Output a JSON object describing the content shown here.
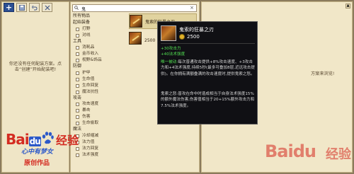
{
  "left_panel": {
    "toolbar": [
      {
        "icon": "plus-icon"
      },
      {
        "icon": "save-icon"
      },
      {
        "icon": "undo-icon"
      },
      {
        "icon": "close-icon"
      }
    ],
    "empty_message": "你还没有任何配装方案。点击“创建”开始配装吧!"
  },
  "search": {
    "value": "鬼",
    "placeholder": ""
  },
  "categories": [
    {
      "label": "所有物品",
      "type": "head"
    },
    {
      "label": "起始装备",
      "type": "head"
    },
    {
      "label": "打野",
      "type": "item"
    },
    {
      "label": "对线",
      "type": "item"
    },
    {
      "label": "工具",
      "type": "head"
    },
    {
      "label": "消耗品",
      "type": "item"
    },
    {
      "label": "金币收入",
      "type": "item"
    },
    {
      "label": "视野&饰品",
      "type": "item"
    },
    {
      "label": "防御",
      "type": "head"
    },
    {
      "label": "护甲",
      "type": "item"
    },
    {
      "label": "生命值",
      "type": "item"
    },
    {
      "label": "生命回复",
      "type": "item"
    },
    {
      "label": "魔法抗性",
      "type": "item"
    },
    {
      "label": "攻击",
      "type": "head"
    },
    {
      "label": "攻击速度",
      "type": "item"
    },
    {
      "label": "暴击",
      "type": "item"
    },
    {
      "label": "伤害",
      "type": "item"
    },
    {
      "label": "生命偷取",
      "type": "item"
    },
    {
      "label": "魔法",
      "type": "head"
    },
    {
      "label": "冷却缩减",
      "type": "item"
    },
    {
      "label": "法力值",
      "type": "item"
    },
    {
      "label": "法力回复",
      "type": "item"
    },
    {
      "label": "法术强度",
      "type": "item"
    }
  ],
  "results": [
    {
      "name": "鬼索的狂暴之刃",
      "price": ""
    },
    {
      "name": "",
      "price": "2500"
    }
  ],
  "right_panel": {
    "message": "方案来浏览!"
  },
  "tooltip": {
    "title": "鬼索的狂暴之刃",
    "price": "2500",
    "stat1": "+30攻击力",
    "stat2": "+40法术强度",
    "passive_label": "唯一被动:",
    "passive_text": "每次普通攻击提供+8%攻击速度、+3攻击力和+4法术强度,持续5秒(最多可叠加8层,近远攻击提供)。在你拥有满额叠满的攻击速度时,提供鬼索之怒。",
    "rage_text": "鬼索之怒:普攻在命中时造成相当于自身法术强度15%的额外魔法伤害,伤害值相当于20+15%额外攻击力和7.5%法术强度。"
  },
  "watermark": {
    "baidu": "Bai",
    "du": "du",
    "jingyan": "经验",
    "slogan": "心中有梦女",
    "original": "原创作品"
  },
  "colors": {
    "tooltip_bg": "#101014",
    "stat_green": "#52e052",
    "panel_bg": "#f1e7c8",
    "plus_button": "#2b4f93",
    "brand_red": "#d42b21",
    "brand_blue": "#2c59c9"
  }
}
